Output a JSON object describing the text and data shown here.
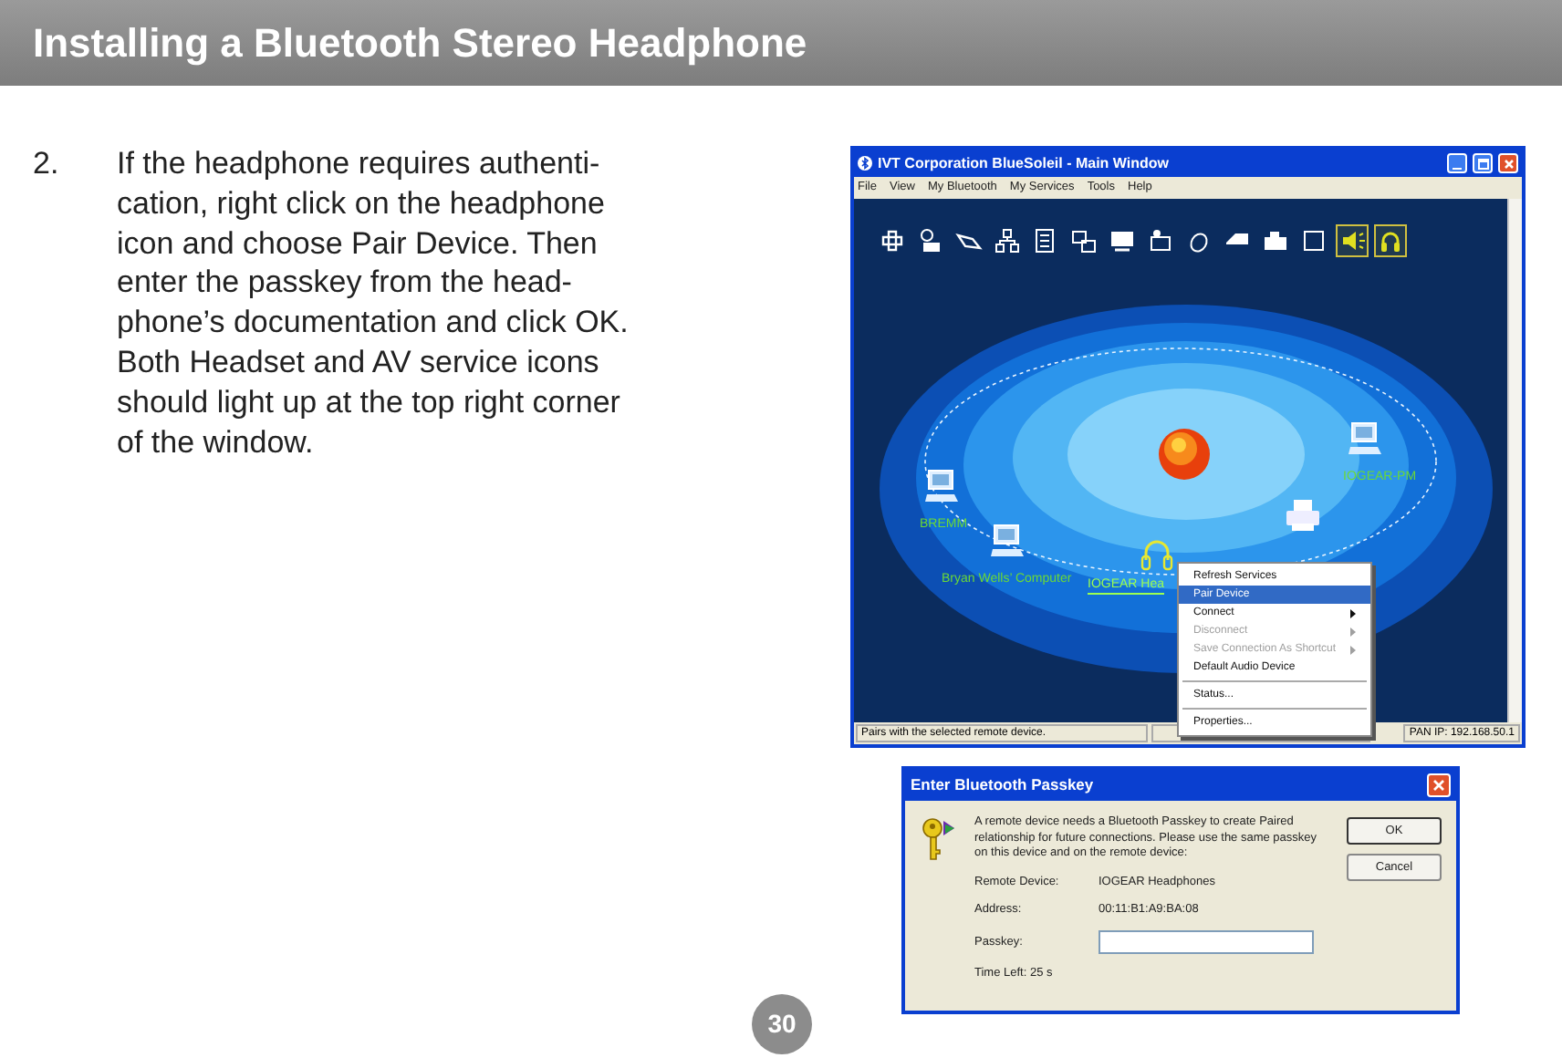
{
  "header": {
    "title": "Installing a Bluetooth Stereo Headphone"
  },
  "step": {
    "number": "2.",
    "text": "If the headphone requires authenti-\ncation, right click on the headphone\nicon and choose Pair Device. Then\nenter the passkey from the head-\nphone’s documentation and click OK.\nBoth Headset and AV service icons\nshould light up at the top right corner\nof the window."
  },
  "main_window": {
    "title": "IVT Corporation BlueSoleil - Main Window",
    "menu": [
      "File",
      "View",
      "My Bluetooth",
      "My Services",
      "Tools",
      "Help"
    ],
    "services": [
      {
        "active": false
      },
      {
        "active": false
      },
      {
        "active": false
      },
      {
        "active": false
      },
      {
        "active": false
      },
      {
        "active": false
      },
      {
        "active": false
      },
      {
        "active": false
      },
      {
        "active": false
      },
      {
        "active": false
      },
      {
        "active": false
      },
      {
        "active": false
      },
      {
        "active": true
      },
      {
        "active": true
      }
    ],
    "devices": [
      {
        "kind": "computer",
        "label": "IOGEAR-PM",
        "selected": false
      },
      {
        "kind": "computer",
        "label": "BREMM",
        "selected": false
      },
      {
        "kind": "computer",
        "label": "Bryan Wells’ Computer",
        "selected": false
      },
      {
        "kind": "headphones",
        "label": "IOGEAR Hea",
        "selected": true
      },
      {
        "kind": "printer",
        "selected": false
      }
    ],
    "context_menu": [
      {
        "kind": "item",
        "label": "Refresh Services",
        "selected": false,
        "disabled": false
      },
      {
        "kind": "item",
        "label": "Pair Device",
        "selected": true,
        "disabled": false
      },
      {
        "kind": "submenu",
        "label": "Connect",
        "selected": false,
        "disabled": false
      },
      {
        "kind": "submenu",
        "label": "Disconnect",
        "selected": false,
        "disabled": true
      },
      {
        "kind": "submenu",
        "label": "Save Connection As Shortcut",
        "selected": false,
        "disabled": true
      },
      {
        "kind": "item",
        "label": "Default Audio Device",
        "selected": false,
        "disabled": false
      },
      {
        "kind": "separator"
      },
      {
        "kind": "item",
        "label": "Status...",
        "selected": false,
        "disabled": false
      },
      {
        "kind": "separator"
      },
      {
        "kind": "item",
        "label": "Properties...",
        "selected": false,
        "disabled": false
      }
    ],
    "status_bar": [
      "Pairs with the selected remote device.",
      "PAN IP: 192.168.50.1"
    ]
  },
  "dialog": {
    "title": "Enter Bluetooth Passkey",
    "message": "A remote device needs a Bluetooth Passkey to create Paired relationship for future connections. Please use the same passkey on this device and on the remote device:",
    "fields": [
      {
        "label": "Remote Device:",
        "value": "IOGEAR Headphones"
      },
      {
        "label": "Address:",
        "value": "00:11:B1:A9:BA:08"
      }
    ],
    "passkey_label": "Passkey:",
    "time_left": "Time Left: 25 s",
    "buttons": [
      "OK",
      "Cancel"
    ]
  },
  "page_number": "30"
}
